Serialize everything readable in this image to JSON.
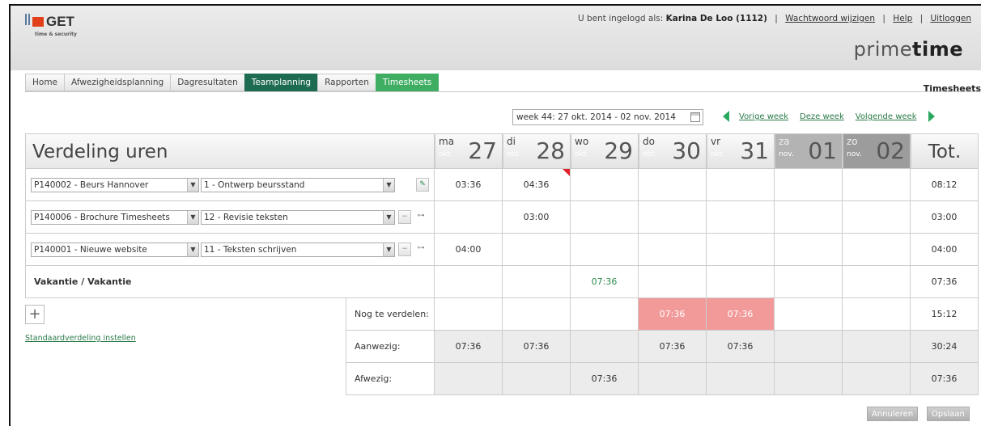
{
  "header": {
    "logo_name": "GET",
    "logo_tagline": "time & security",
    "logged_in_prefix": "U bent ingelogd als:",
    "user": "Karina De Loo (1112)",
    "change_password": "Wachtwoord wijzigen",
    "help": "Help",
    "logout": "Uitloggen",
    "separator": "|",
    "brand_prefix": "prime",
    "brand_suffix": "time"
  },
  "tabs": [
    {
      "label": "Home"
    },
    {
      "label": "Afwezigheidsplanning"
    },
    {
      "label": "Dagresultaten"
    },
    {
      "label": "Teamplanning"
    },
    {
      "label": "Rapporten"
    },
    {
      "label": "Timesheets"
    }
  ],
  "section_title": "Timesheets",
  "week_selector": {
    "value": "week 44: 27 okt. 2014 - 02 nov. 2014",
    "prev_week": "Vorige week",
    "this_week": "Deze week",
    "next_week": "Volgende week"
  },
  "table": {
    "title": "Verdeling uren",
    "total_header": "Tot.",
    "days": [
      {
        "abbr": "ma",
        "month": "okt.",
        "num": "27"
      },
      {
        "abbr": "di",
        "month": "okt.",
        "num": "28"
      },
      {
        "abbr": "wo",
        "month": "okt.",
        "num": "29"
      },
      {
        "abbr": "do",
        "month": "okt.",
        "num": "30"
      },
      {
        "abbr": "vr",
        "month": "okt.",
        "num": "31"
      },
      {
        "abbr": "za",
        "month": "nov.",
        "num": "01"
      },
      {
        "abbr": "zo",
        "month": "nov.",
        "num": "02"
      }
    ],
    "rows": [
      {
        "project": "P140002 - Beurs Hannover",
        "task": "1 - Ontwerp beursstand",
        "values": [
          "03:36",
          "04:36",
          "",
          "",
          "",
          "",
          ""
        ],
        "total": "08:12"
      },
      {
        "project": "P140006 - Brochure Timesheets",
        "task": "12 - Revisie teksten",
        "values": [
          "",
          "03:00",
          "",
          "",
          "",
          "",
          ""
        ],
        "total": "03:00"
      },
      {
        "project": "P140001 - Nieuwe website",
        "task": "11 - Teksten schrijven",
        "values": [
          "04:00",
          "",
          "",
          "",
          "",
          "",
          ""
        ],
        "total": "04:00"
      }
    ],
    "vacation": {
      "label": "Vakantie / Vakantie",
      "values": [
        "",
        "",
        "07:36",
        "",
        "",
        "",
        ""
      ],
      "total": "07:36"
    },
    "summary": [
      {
        "label": "Nog te verdelen:",
        "values": [
          "",
          "",
          "",
          "07:36",
          "07:36",
          "",
          ""
        ],
        "total": "15:12"
      },
      {
        "label": "Aanwezig:",
        "values": [
          "07:36",
          "07:36",
          "",
          "07:36",
          "07:36",
          "",
          ""
        ],
        "total": "30:24"
      },
      {
        "label": "Afwezig:",
        "values": [
          "",
          "",
          "07:36",
          "",
          "",
          "",
          ""
        ],
        "total": "07:36"
      }
    ]
  },
  "add_symbol": "+",
  "standard_link": "Standaardverdeling instellen",
  "buttons": {
    "cancel": "Annuleren",
    "save": "Opslaan"
  },
  "colors": {
    "accent_dark": "#1d6b50",
    "accent_green": "#3fae63",
    "warning": "#f29a9a",
    "logo_red": "#e2401b"
  }
}
